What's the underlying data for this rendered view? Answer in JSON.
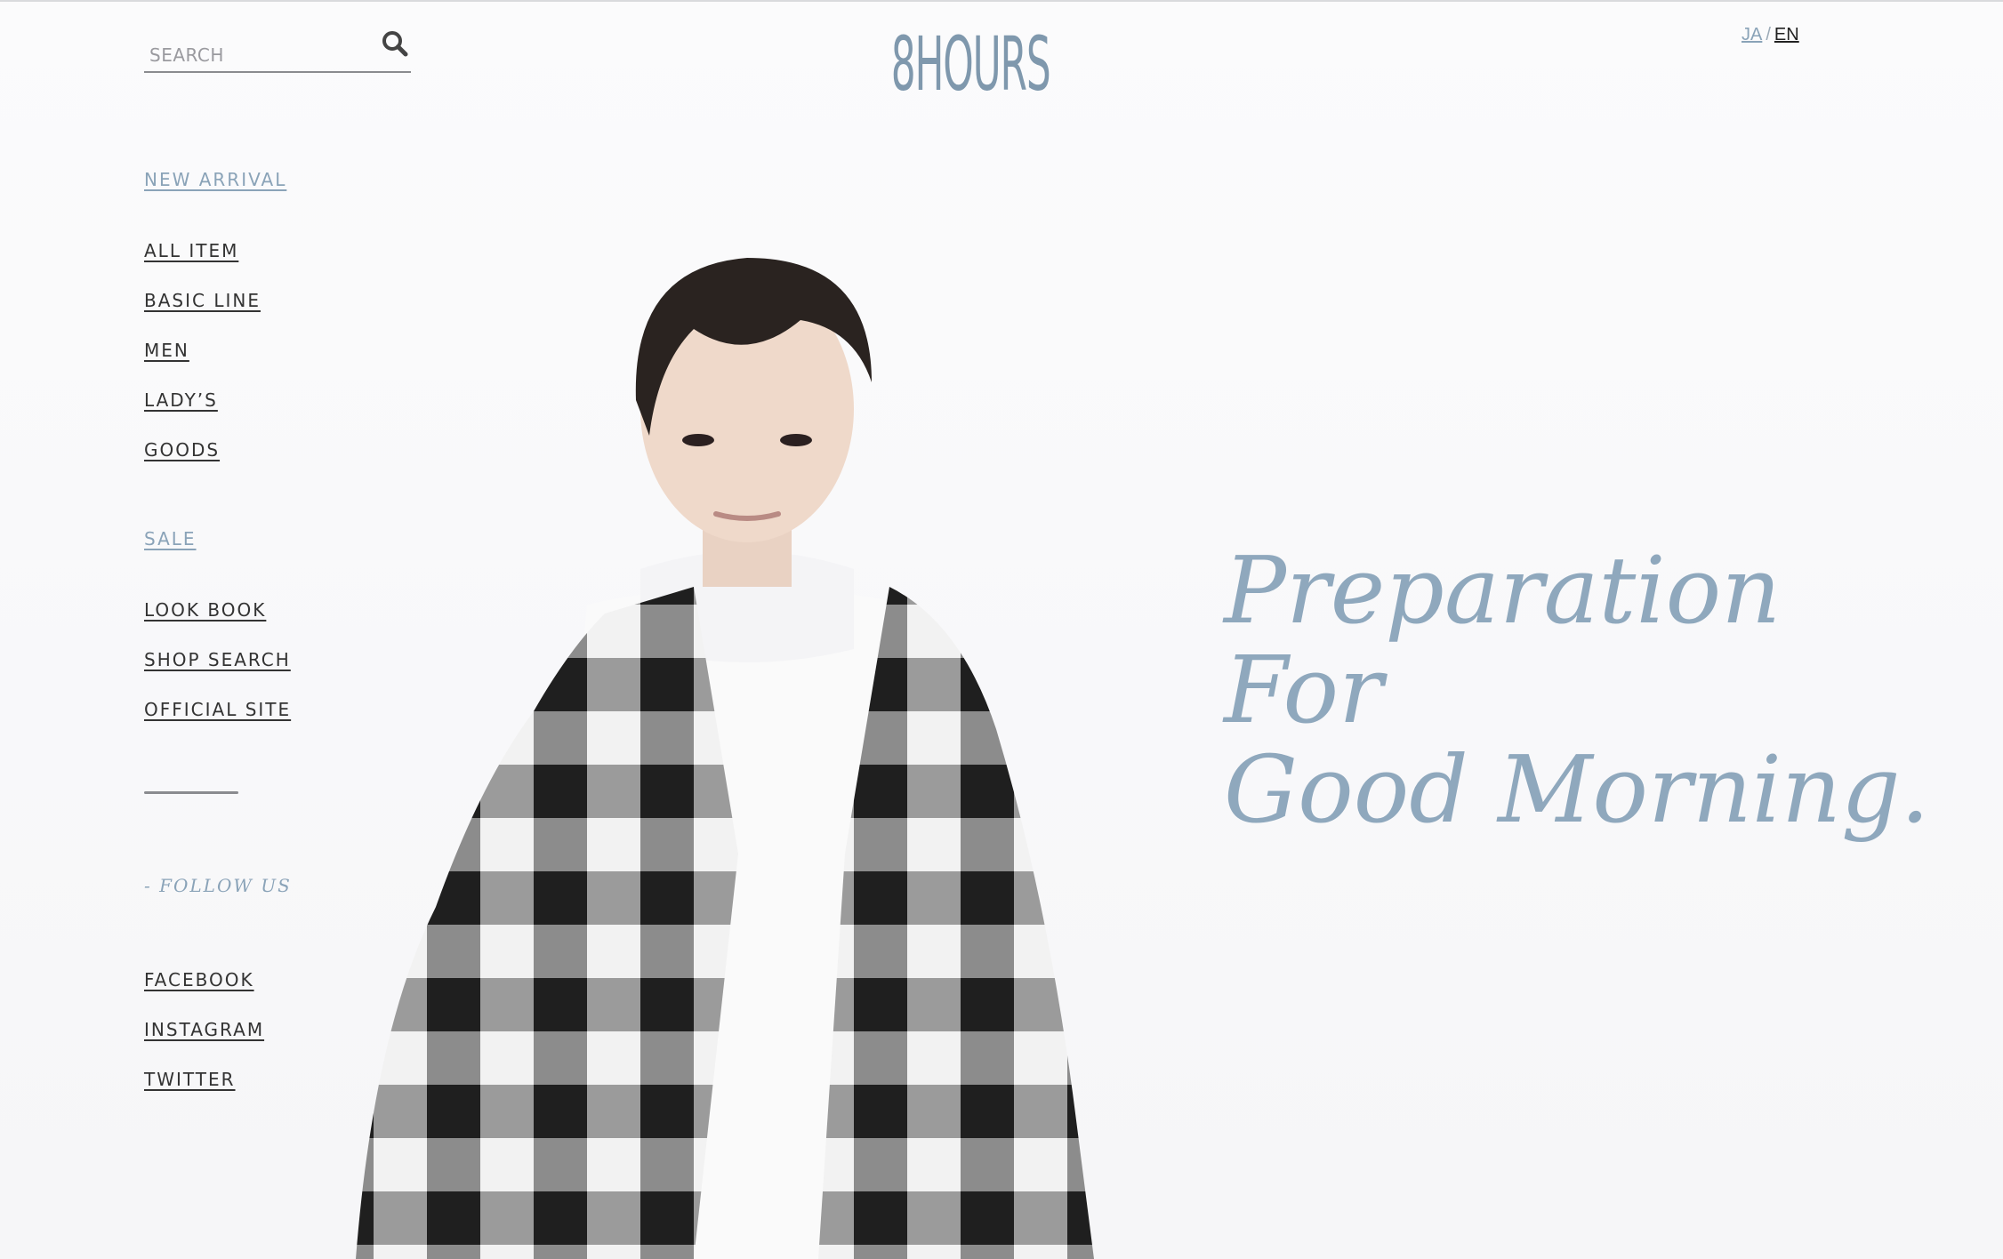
{
  "header": {
    "search_placeholder": "SEARCH",
    "logo_text": "8HOURS",
    "lang_ja": "JA",
    "lang_sep": "/",
    "lang_en": "EN"
  },
  "nav": {
    "new_arrival": "NEW ARRIVAL",
    "items": [
      "ALL ITEM",
      "BASIC LINE",
      "MEN",
      "LADY’S",
      "GOODS"
    ],
    "sale": "SALE",
    "links": [
      "LOOK BOOK",
      "SHOP SEARCH",
      "OFFICIAL SITE"
    ],
    "follow_us": "- FOLLOW US",
    "social": [
      "FACEBOOK",
      "INSTAGRAM",
      "TWITTER"
    ]
  },
  "hero": {
    "line1": "Preparation",
    "line2": "For",
    "line3": "Good Morning."
  },
  "colors": {
    "accent": "#8aa3b8",
    "text": "#333333",
    "background": "#f9f9fb"
  }
}
